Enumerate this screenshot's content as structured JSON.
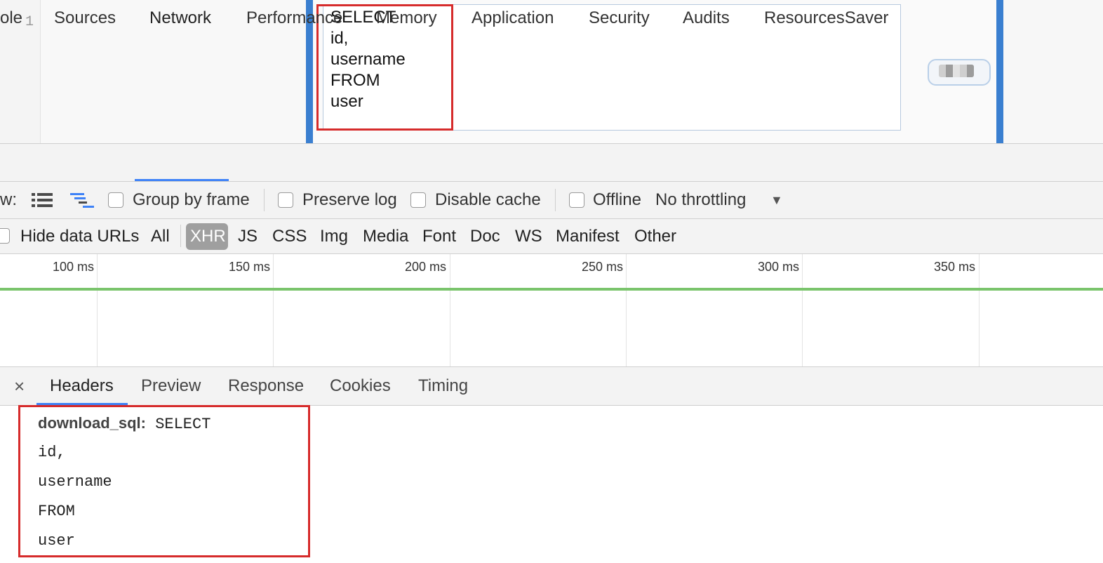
{
  "editor": {
    "line_number": "1",
    "sql_lines": [
      "SELECT",
      "id,",
      "username",
      "FROM",
      "user"
    ]
  },
  "devtools": {
    "tabs": [
      "ole",
      "Sources",
      "Network",
      "Performance",
      "Memory",
      "Application",
      "Security",
      "Audits",
      "ResourcesSaver"
    ],
    "active_tab": "Network"
  },
  "toolbar": {
    "view_label": "w:",
    "group_by_frame": "Group by frame",
    "preserve_log": "Preserve log",
    "disable_cache": "Disable cache",
    "offline": "Offline",
    "throttling": "No throttling",
    "throttle_arrow": "▼"
  },
  "filters": {
    "hide_data_urls": "Hide data URLs",
    "types": [
      "All",
      "XHR",
      "JS",
      "CSS",
      "Img",
      "Media",
      "Font",
      "Doc",
      "WS",
      "Manifest",
      "Other"
    ],
    "active_type": "XHR"
  },
  "timeline": {
    "ticks": [
      "100 ms",
      "150 ms",
      "200 ms",
      "250 ms",
      "300 ms",
      "350 ms"
    ]
  },
  "details": {
    "close": "×",
    "tabs": [
      "Headers",
      "Preview",
      "Response",
      "Cookies",
      "Timing"
    ],
    "active_tab": "Headers",
    "header_key": "download_sql:",
    "header_value_lines": [
      "SELECT",
      "id,",
      "username",
      "FROM",
      "user"
    ]
  },
  "colors": {
    "highlight_red": "#d62b2b",
    "tab_underline_blue": "#3e82f7",
    "timeline_green": "#7ac46c",
    "accent_blue": "#3a7fd0"
  }
}
